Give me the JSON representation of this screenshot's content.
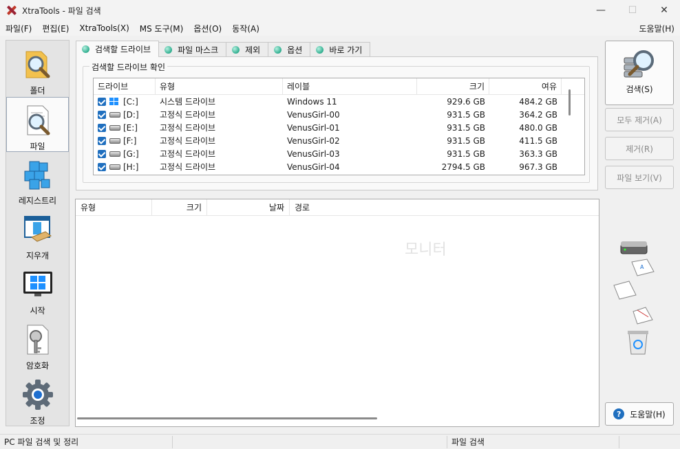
{
  "window": {
    "title": "XtraTools - 파일 검색",
    "minimize": "—",
    "maximize": "☐",
    "close": "✕"
  },
  "menu": {
    "items": [
      "파일(F)",
      "편집(E)",
      "XtraTools(X)",
      "MS 도구(M)",
      "옵션(O)",
      "동작(A)"
    ],
    "help": "도움말(H)"
  },
  "nav": [
    {
      "label": "폴더",
      "icon": "folder-search-icon"
    },
    {
      "label": "파일",
      "icon": "file-search-icon"
    },
    {
      "label": "레지스트리",
      "icon": "registry-cubes-icon"
    },
    {
      "label": "지우개",
      "icon": "eraser-icon"
    },
    {
      "label": "시작",
      "icon": "windows-start-icon"
    },
    {
      "label": "암호화",
      "icon": "key-lock-icon"
    },
    {
      "label": "조정",
      "icon": "gear-icon"
    }
  ],
  "tabs": [
    "검색할 드라이브",
    "파일 마스크",
    "제외",
    "옵션",
    "바로 가기"
  ],
  "drive_group_title": "검색할 드라이브 확인",
  "drive_columns": [
    "드라이브",
    "유형",
    "레이블",
    "크기",
    "여유"
  ],
  "drives": [
    {
      "drive": "[C:]",
      "type": "시스템 드라이브",
      "label": "Windows 11",
      "size": "929.6 GB",
      "free": "484.2 GB",
      "checked": true,
      "system": true
    },
    {
      "drive": "[D:]",
      "type": "고정식 드라이브",
      "label": "VenusGirl-00",
      "size": "931.5 GB",
      "free": "364.2 GB",
      "checked": true,
      "system": false
    },
    {
      "drive": "[E:]",
      "type": "고정식 드라이브",
      "label": "VenusGirl-01",
      "size": "931.5 GB",
      "free": "480.0 GB",
      "checked": true,
      "system": false
    },
    {
      "drive": "[F:]",
      "type": "고정식 드라이브",
      "label": "VenusGirl-02",
      "size": "931.5 GB",
      "free": "411.5 GB",
      "checked": true,
      "system": false
    },
    {
      "drive": "[G:]",
      "type": "고정식 드라이브",
      "label": "VenusGirl-03",
      "size": "931.5 GB",
      "free": "363.3 GB",
      "checked": true,
      "system": false
    },
    {
      "drive": "[H:]",
      "type": "고정식 드라이브",
      "label": "VenusGirl-04",
      "size": "2794.5 GB",
      "free": "967.3 GB",
      "checked": true,
      "system": false
    }
  ],
  "result_columns": [
    "유형",
    "크기",
    "날짜",
    "경로"
  ],
  "actions": {
    "search": "검색(S)",
    "remove_all": "모두 제거(A)",
    "remove": "제거(R)",
    "view_file": "파일 보기(V)",
    "help": "도움말(H)"
  },
  "status": {
    "left": "PC 파일 검색 및 정리",
    "middle": "",
    "right": "파일 검색"
  },
  "accent_color": "#1f6fbf"
}
